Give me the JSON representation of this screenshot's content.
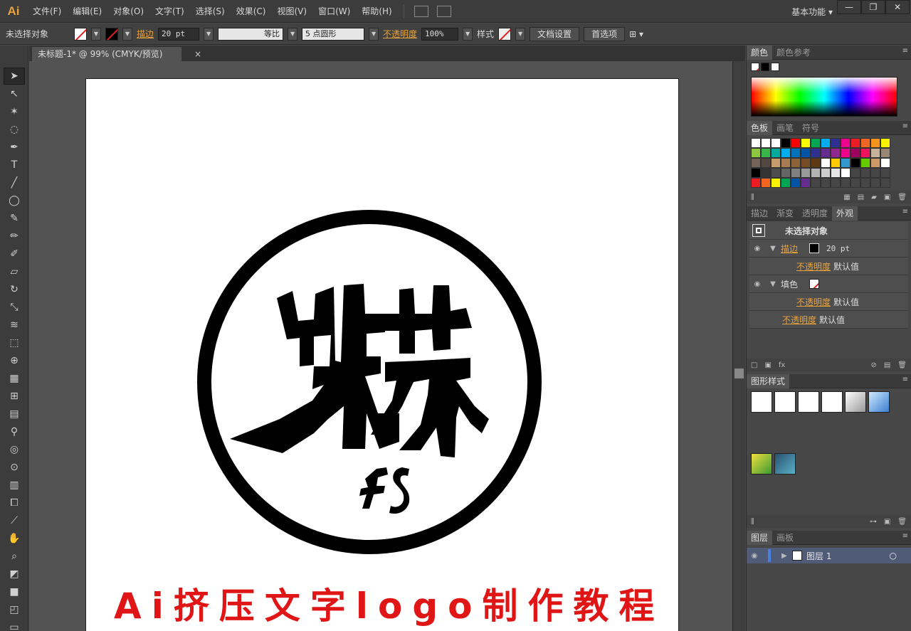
{
  "app": {
    "logo": "Ai",
    "menus": [
      "文件(F)",
      "编辑(E)",
      "对象(O)",
      "文字(T)",
      "选择(S)",
      "效果(C)",
      "视图(V)",
      "窗口(W)",
      "帮助(H)"
    ],
    "workspace": "基本功能",
    "window_buttons": [
      "—",
      "❐",
      "✕"
    ]
  },
  "control": {
    "selection": "未选择对象",
    "stroke_label": "描边",
    "stroke_value": "20 pt",
    "stroke_profile": "等比",
    "brush": "5 点圆形",
    "opacity_label": "不透明度",
    "opacity_value": "100%",
    "style_label": "样式",
    "doc_setup": "文档设置",
    "preferences": "首选项"
  },
  "document": {
    "tab_title": "未标题-1* @ 99% (CMYK/预览)",
    "close": "×"
  },
  "artwork": {
    "main_text": "扶苏",
    "sub_text": "FS"
  },
  "caption": "Ai挤压文字logo制作教程",
  "panels": {
    "color": {
      "tabs": [
        "颜色",
        "颜色参考"
      ]
    },
    "swatches": {
      "tabs": [
        "色板",
        "画笔",
        "符号"
      ]
    },
    "appearance": {
      "tabs": [
        "描边",
        "渐变",
        "透明度",
        "外观"
      ],
      "title": "未选择对象",
      "stroke_label": "描边",
      "stroke_value": "20 pt",
      "opacity_label": "不透明度",
      "opacity_value": "默认值",
      "fill_label": "填色"
    },
    "graphic_styles": {
      "tabs": [
        "图形样式"
      ]
    },
    "layers": {
      "tabs": [
        "图层",
        "画板"
      ],
      "layer_name": "图层 1"
    }
  },
  "colors": {
    "accent": "#e8a23c",
    "caption": "#e01515",
    "swatches": [
      "#ffffff",
      "#ffffff",
      "#ffffff",
      "#000000",
      "#ff0000",
      "#ffff00",
      "#00a651",
      "#00aeef",
      "#2e3192",
      "#ec008c",
      "#ed1c24",
      "#f26522",
      "#f7941d",
      "#fff200",
      "#8dc63f",
      "#39b54a",
      "#00a99d",
      "#00aeef",
      "#0072bc",
      "#0054a6",
      "#2e3192",
      "#662d91",
      "#92278f",
      "#ec008c",
      "#9e005d",
      "#ed145b",
      "#c7b299",
      "#998675",
      "#736357",
      "#534741",
      "#c69c6d",
      "#a67c52",
      "#8c6239",
      "#754c24",
      "#603913",
      "#ffffff",
      "#ffcc00",
      "#3399cc",
      "#000000",
      "#66cc00",
      "#cc9966",
      "#ffffff",
      "#000000",
      "#333333",
      "#4d4d4d",
      "#666666",
      "#808080",
      "#999999",
      "#b3b3b3",
      "#cccccc",
      "#e6e6e6",
      "#ffffff",
      "#464646",
      "#464646",
      "#464646",
      "#464646",
      "#ed1c24",
      "#f26522",
      "#fff200",
      "#00a651",
      "#0054a6",
      "#662d91",
      "#464646",
      "#464646",
      "#464646",
      "#464646",
      "#464646",
      "#464646",
      "#464646",
      "#464646"
    ]
  }
}
